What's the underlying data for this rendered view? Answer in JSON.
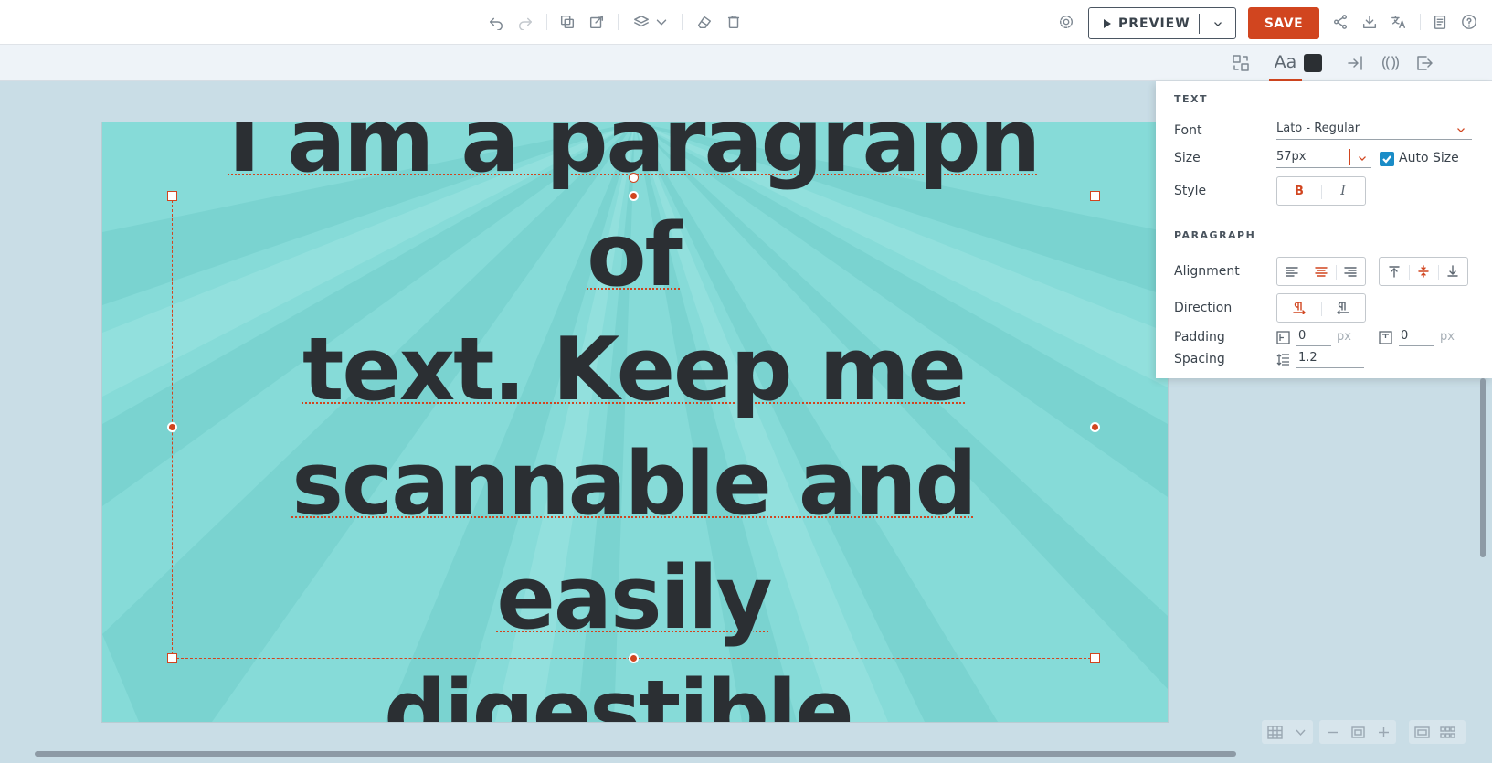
{
  "toolbar": {
    "preview_label": "PREVIEW",
    "save_label": "SAVE"
  },
  "canvas": {
    "background": "#86dbd8",
    "paragraph_lines": [
      "I am a paragraph of",
      "text. Keep me",
      "scannable and easily",
      "digestible."
    ],
    "text_color": "#2b2f33",
    "selection_color": "#d1451f"
  },
  "panel": {
    "text_heading": "TEXT",
    "font_label": "Font",
    "font_value": "Lato - Regular",
    "size_label": "Size",
    "size_value": "57px",
    "auto_size_label": "Auto Size",
    "style_label": "Style",
    "paragraph_heading": "PARAGRAPH",
    "alignment_label": "Alignment",
    "direction_label": "Direction",
    "padding_label": "Padding",
    "padding_h_value": "0",
    "padding_v_value": "0",
    "padding_unit": "px",
    "spacing_label": "Spacing",
    "spacing_value": "1.2",
    "style_bold": "B",
    "style_italic": "I"
  },
  "colors": {
    "accent": "#d1451f",
    "checkbox": "#1a8cc7",
    "text_swatch": "#2b2f33"
  }
}
